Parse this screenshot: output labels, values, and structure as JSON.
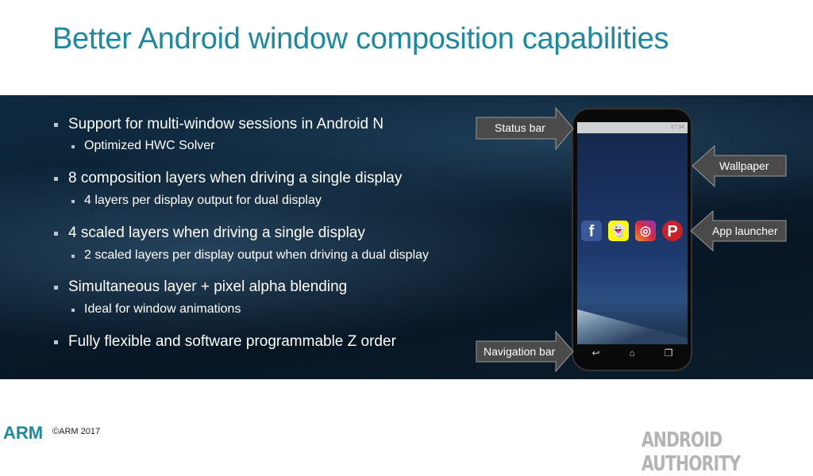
{
  "title": "Better Android window composition capabilities",
  "bullets": [
    {
      "text": "Support for multi-window sessions in Android N",
      "sub": "Optimized HWC Solver"
    },
    {
      "text": "8 composition layers when driving a single display",
      "sub": "4 layers per display output for dual display"
    },
    {
      "text": "4 scaled layers when driving a single display",
      "sub": "2 scaled layers per display output when driving a dual display"
    },
    {
      "text": "Simultaneous layer + pixel alpha blending",
      "sub": "Ideal for window animations"
    },
    {
      "text": "Fully flexible and software programmable Z order"
    }
  ],
  "callouts": {
    "status_bar": "Status bar",
    "wallpaper": "Wallpaper",
    "app_launcher": "App launcher",
    "navigation_bar": "Navigation bar"
  },
  "phone": {
    "clock": "17:34",
    "apps": [
      "facebook",
      "snapchat",
      "instagram",
      "pinterest"
    ]
  },
  "footer": {
    "logo": "ARM",
    "copyright": "©ARM 2017",
    "watermark": "ANDROID AUTHORITY"
  },
  "colors": {
    "title": "#1b8aa0",
    "panel": "#0b1e30",
    "callout": "#4a4a4a"
  }
}
